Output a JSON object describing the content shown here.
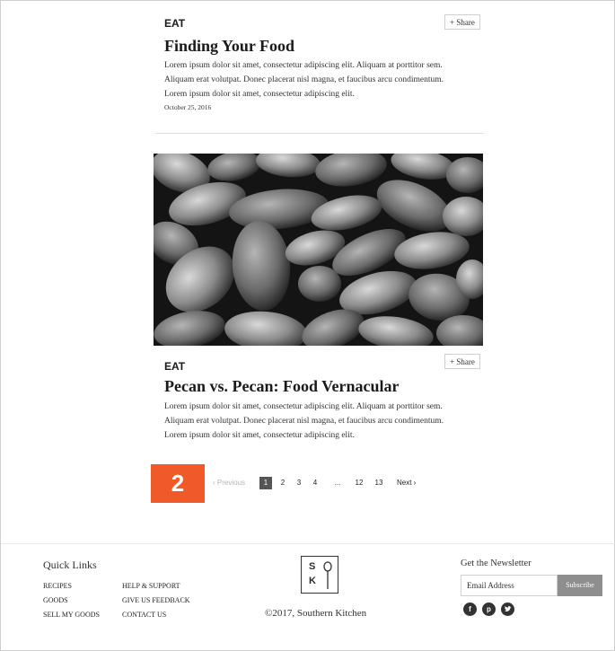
{
  "article1": {
    "category": "EAT",
    "title": "Finding Your Food",
    "body": "Lorem ipsum dolor sit amet, consectetur adipiscing elit. Aliquam at porttitor sem. Aliquam erat volutpat. Donec placerat nisl magna, et faucibus arcu condimentum. Lorem ipsum dolor sit amet, consectetur adipiscing elit.",
    "date": "October 25, 2016",
    "share_label": "+ Share"
  },
  "article2": {
    "category": "EAT",
    "title": "Pecan vs. Pecan: Food Vernacular",
    "body": "Lorem ipsum dolor sit amet, consectetur adipiscing elit. Aliquam at porttitor sem. Aliquam erat volutpat. Donec placerat nisl magna, et faucibus arcu condimentum. Lorem ipsum dolor sit amet, consectetur adipiscing elit.",
    "share_label": "+ Share"
  },
  "step_badge": "2",
  "pagination": {
    "previous": "‹ Previous",
    "pages": [
      "1",
      "2",
      "3",
      "4",
      "...",
      "12",
      "13"
    ],
    "current": "1",
    "next": "Next ›"
  },
  "footer": {
    "quick_links_heading": "Quick Links",
    "links_col1": [
      "RECIPES",
      "GOODS",
      "SELL MY GOODS"
    ],
    "links_col2": [
      "HELP & SUPPORT",
      "GIVE US FEEDBACK",
      "CONTACT US"
    ],
    "logo_letters": [
      "S",
      "K"
    ],
    "copyright": "©2017, Southern Kitchen",
    "newsletter_heading": "Get the Newsletter",
    "email_placeholder": "Email Address",
    "subscribe_label": "Subscribe",
    "social_icons": [
      "facebook-icon",
      "pinterest-icon",
      "twitter-icon"
    ]
  }
}
